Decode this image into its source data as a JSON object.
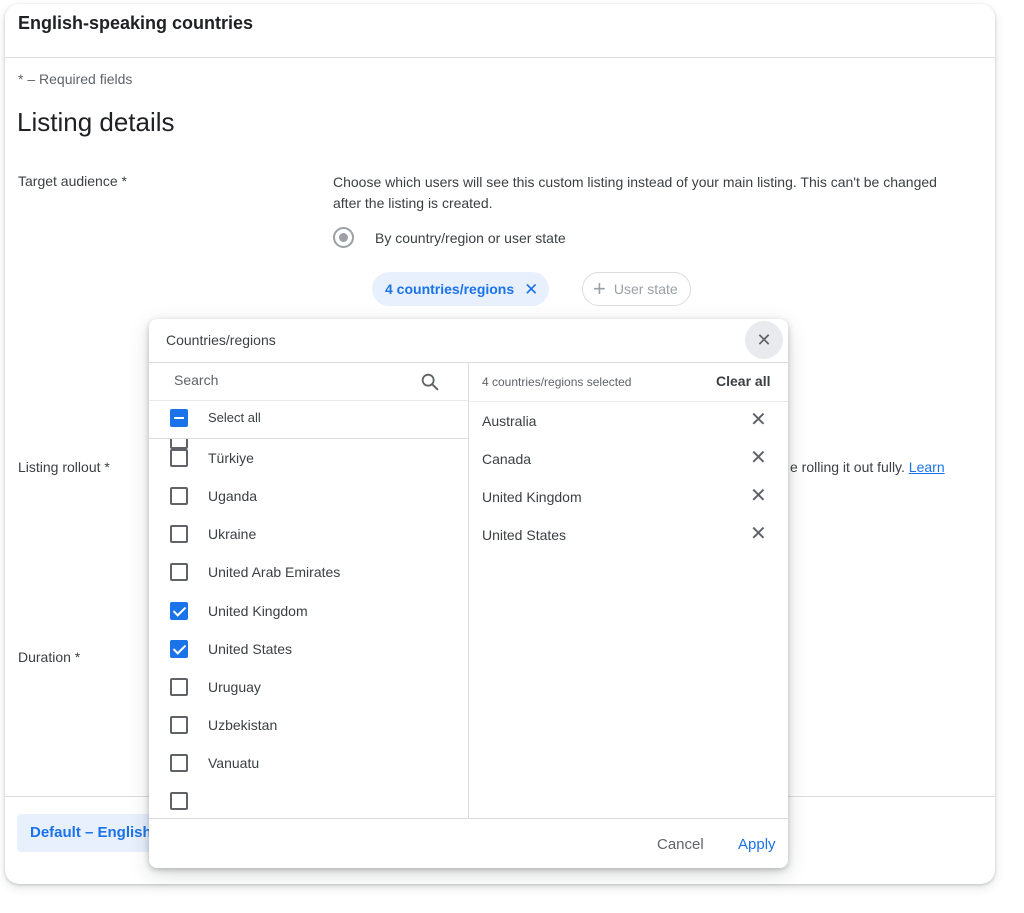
{
  "card": {
    "title": "English-speaking countries"
  },
  "required_note": "* – Required fields",
  "section_title": "Listing details",
  "labels": {
    "target_audience": "Target audience  *",
    "listing_rollout": "Listing rollout  *",
    "duration": "Duration  *"
  },
  "target_description": "Choose which users will see this custom listing instead of your main listing. This can't be changed after the listing is created.",
  "radio": {
    "label": "By country/region or user state"
  },
  "chips": {
    "countries_label": "4 countries/regions",
    "countries_remove": "✕",
    "user_state_label": "User state",
    "user_state_plus": "+"
  },
  "rollout_text": "e rolling it out fully.",
  "learn_link": "Learn",
  "default_button": "Default – English",
  "dialog": {
    "title": "Countries/regions",
    "close_glyph": "✕",
    "search_placeholder": "Search",
    "select_all": "Select all",
    "selected_count": "4 countries/regions selected",
    "clear_all": "Clear all",
    "countries": [
      {
        "name": "Türkiye",
        "checked": false
      },
      {
        "name": "Uganda",
        "checked": false
      },
      {
        "name": "Ukraine",
        "checked": false
      },
      {
        "name": "United Arab Emirates",
        "checked": false
      },
      {
        "name": "United Kingdom",
        "checked": true
      },
      {
        "name": "United States",
        "checked": true
      },
      {
        "name": "Uruguay",
        "checked": false
      },
      {
        "name": "Uzbekistan",
        "checked": false
      },
      {
        "name": "Vanuatu",
        "checked": false
      }
    ],
    "selected": [
      "Australia",
      "Canada",
      "United Kingdom",
      "United States"
    ],
    "remove_glyph": "✕",
    "cancel": "Cancel",
    "apply": "Apply"
  },
  "colors": {
    "accent": "#1a73e8",
    "chip_bg": "#e8f0fe",
    "border": "#dadce0"
  }
}
